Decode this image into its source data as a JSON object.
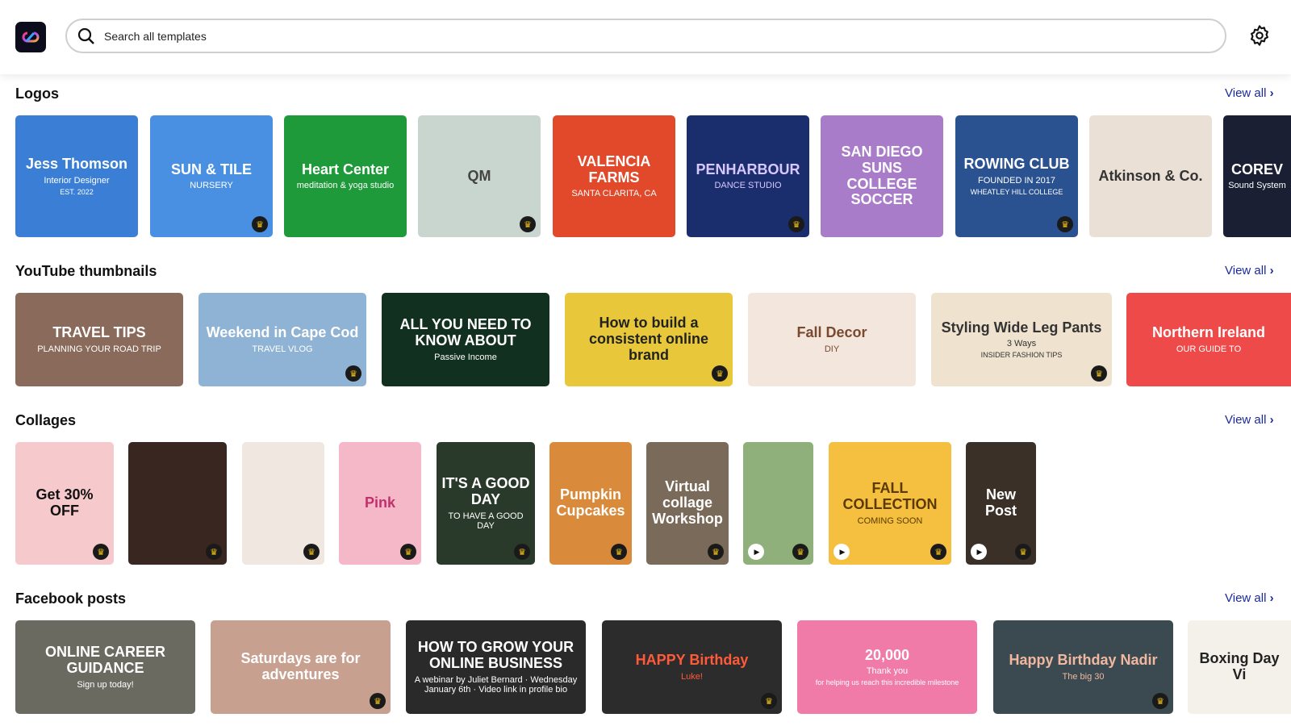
{
  "header": {
    "search_placeholder": "Search all templates",
    "app_icon": "creative-cloud-logo",
    "settings_icon": "gear-icon"
  },
  "accent": "#1b2a9a",
  "sections": [
    {
      "title": "Logos",
      "view_all": "View all",
      "tiles": [
        {
          "bg": "#3a7fd5",
          "fg": "#fff",
          "lines": [
            "Jess Thomson",
            "Interior Designer",
            "EST. 2022"
          ],
          "premium": false
        },
        {
          "bg": "#4a90e2",
          "fg": "#fff",
          "lines": [
            "SUN & TILE",
            "NURSERY"
          ],
          "premium": true
        },
        {
          "bg": "#1f9a3a",
          "fg": "#fff",
          "lines": [
            "Heart Center",
            "meditation & yoga studio"
          ],
          "premium": false
        },
        {
          "bg": "#c9d6cf",
          "fg": "#444",
          "lines": [
            "QM"
          ],
          "premium": true
        },
        {
          "bg": "#e2492a",
          "fg": "#fff",
          "lines": [
            "VALENCIA FARMS",
            "SANTA CLARITA, CA"
          ],
          "premium": false
        },
        {
          "bg": "#1a2e6e",
          "fg": "#d9c8ff",
          "lines": [
            "PENHARBOUR",
            "DANCE STUDIO"
          ],
          "premium": true
        },
        {
          "bg": "#a97cc9",
          "fg": "#fff",
          "lines": [
            "SAN DIEGO SUNS COLLEGE SOCCER"
          ],
          "premium": false
        },
        {
          "bg": "#2a5291",
          "fg": "#fff",
          "lines": [
            "ROWING CLUB",
            "FOUNDED IN 2017",
            "WHEATLEY HILL COLLEGE"
          ],
          "premium": true
        },
        {
          "bg": "#ebe0d6",
          "fg": "#333",
          "lines": [
            "Atkinson & Co."
          ],
          "premium": false
        },
        {
          "bg": "#1a1f33",
          "fg": "#fff",
          "lines": [
            "COREV",
            "Sound System"
          ],
          "premium": false
        }
      ]
    },
    {
      "title": "YouTube thumbnails",
      "view_all": "View all",
      "tiles": [
        {
          "bg": "#8a6a5a",
          "fg": "#fff",
          "lines": [
            "TRAVEL TIPS",
            "PLANNING YOUR ROAD TRIP"
          ],
          "premium": false
        },
        {
          "bg": "#8fb3d4",
          "fg": "#fff",
          "lines": [
            "Weekend in Cape Cod",
            "TRAVEL VLOG"
          ],
          "premium": true
        },
        {
          "bg": "#12301f",
          "fg": "#fff",
          "lines": [
            "ALL YOU NEED TO KNOW ABOUT",
            "Passive Income"
          ],
          "premium": false
        },
        {
          "bg": "#e8c83a",
          "fg": "#222",
          "lines": [
            "How to build a consistent online brand"
          ],
          "premium": true
        },
        {
          "bg": "#f3e6dc",
          "fg": "#7a4a30",
          "lines": [
            "Fall Decor",
            "DIY"
          ],
          "premium": false
        },
        {
          "bg": "#efe2cf",
          "fg": "#333",
          "lines": [
            "Styling Wide Leg Pants",
            "3 Ways",
            "INSIDER FASHION TIPS"
          ],
          "premium": true
        },
        {
          "bg": "#ef4a4a",
          "fg": "#fff",
          "lines": [
            "Northern Ireland",
            "OUR GUIDE TO"
          ],
          "premium": false
        }
      ]
    },
    {
      "title": "Collages",
      "view_all": "View all",
      "tiles": [
        {
          "bg": "#f6c9cc",
          "fg": "#111",
          "lines": [
            "Get 30% OFF"
          ],
          "premium": true
        },
        {
          "bg": "#3a2620",
          "fg": "#fff",
          "lines": [],
          "premium": true
        },
        {
          "bg": "#efe7e0",
          "fg": "#333",
          "lines": [],
          "premium": true
        },
        {
          "bg": "#f5b8c8",
          "fg": "#c0306a",
          "lines": [
            "Pink"
          ],
          "premium": true
        },
        {
          "bg": "#2a3a2a",
          "fg": "#fff",
          "lines": [
            "IT'S A GOOD DAY",
            "TO HAVE A GOOD DAY"
          ],
          "premium": true
        },
        {
          "bg": "#d98a3a",
          "fg": "#fff",
          "lines": [
            "Pumpkin Cupcakes"
          ],
          "premium": true
        },
        {
          "bg": "#7a6a5a",
          "fg": "#fff",
          "lines": [
            "Virtual collage Workshop"
          ],
          "premium": true
        },
        {
          "bg": "#8fb07a",
          "fg": "#fff",
          "lines": [],
          "premium": true,
          "video": true
        },
        {
          "bg": "#f5c040",
          "fg": "#5a3a00",
          "lines": [
            "FALL COLLECTION",
            "COMING SOON"
          ],
          "premium": true,
          "video": true
        },
        {
          "bg": "#3a3028",
          "fg": "#fff",
          "lines": [
            "New Post"
          ],
          "premium": true,
          "video": true
        }
      ]
    },
    {
      "title": "Facebook posts",
      "view_all": "View all",
      "tiles": [
        {
          "bg": "#6a6a60",
          "fg": "#fff",
          "lines": [
            "ONLINE CAREER GUIDANCE",
            "Sign up today!"
          ],
          "premium": false
        },
        {
          "bg": "#c8a090",
          "fg": "#fff",
          "lines": [
            "Saturdays are for adventures"
          ],
          "premium": true
        },
        {
          "bg": "#2a2a2a",
          "fg": "#fff",
          "lines": [
            "HOW TO GROW YOUR ONLINE BUSINESS",
            "A webinar by Juliet Bernard · Wednesday January 6th · Video link in profile bio"
          ],
          "premium": false
        },
        {
          "bg": "#2c2c2c",
          "fg": "#ff5a3a",
          "lines": [
            "HAPPY Birthday",
            "Luke!"
          ],
          "premium": true
        },
        {
          "bg": "#f07aa8",
          "fg": "#fff",
          "lines": [
            "20,000",
            "Thank you",
            "for helping us reach this incredible milestone"
          ],
          "premium": false
        },
        {
          "bg": "#3a4a50",
          "fg": "#f0b8a0",
          "lines": [
            "Happy Birthday Nadir",
            "The big 30"
          ],
          "premium": true
        },
        {
          "bg": "#f4f0ea",
          "fg": "#222",
          "lines": [
            "Boxing Day Vi"
          ],
          "premium": false
        }
      ]
    }
  ]
}
